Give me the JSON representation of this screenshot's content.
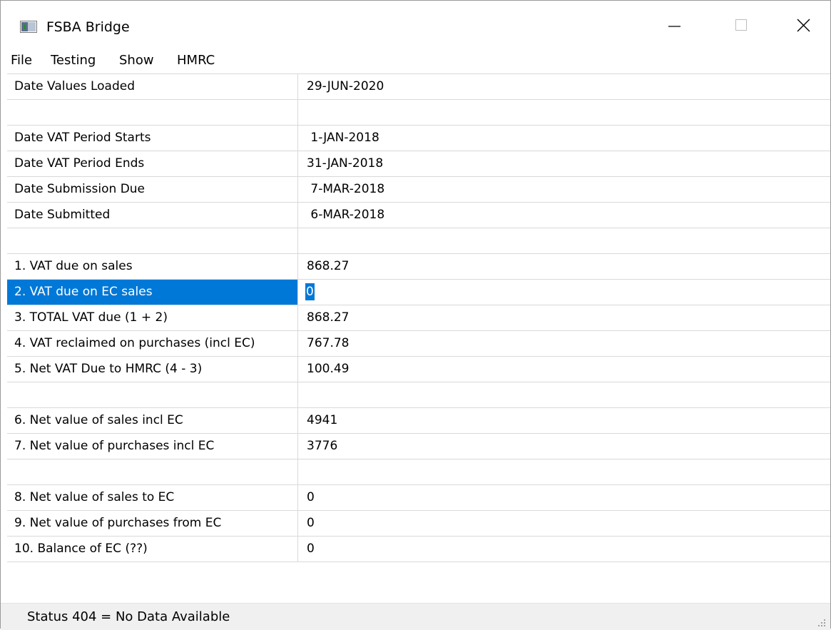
{
  "window": {
    "title": "FSBA Bridge",
    "icon": "app-window-icon",
    "controls": [
      "minimize-icon",
      "maximize-icon",
      "close-icon"
    ]
  },
  "menu": {
    "items": [
      "File",
      "Testing",
      "Show",
      "HMRC"
    ]
  },
  "rows": [
    {
      "label": "Date Values Loaded",
      "value": "29-JUN-2020"
    },
    {
      "label": "",
      "value": ""
    },
    {
      "label": "Date VAT Period Starts",
      "value": " 1-JAN-2018"
    },
    {
      "label": "Date VAT Period Ends",
      "value": "31-JAN-2018"
    },
    {
      "label": "Date Submission Due",
      "value": " 7-MAR-2018"
    },
    {
      "label": "Date Submitted",
      "value": " 6-MAR-2018"
    },
    {
      "label": "",
      "value": ""
    },
    {
      "label": "1. VAT due on sales",
      "value": "868.27"
    },
    {
      "label": "2. VAT due on EC sales",
      "value": "0"
    },
    {
      "label": "3. TOTAL VAT due (1 + 2)",
      "value": "868.27"
    },
    {
      "label": "4. VAT reclaimed on purchases (incl EC)",
      "value": "767.78"
    },
    {
      "label": "5. Net VAT Due to HMRC (4 - 3)",
      "value": "100.49"
    },
    {
      "label": "",
      "value": ""
    },
    {
      "label": "6. Net value of sales incl EC",
      "value": "4941"
    },
    {
      "label": "7. Net value of purchases incl EC",
      "value": "3776"
    },
    {
      "label": "",
      "value": ""
    },
    {
      "label": "8. Net value of sales to EC",
      "value": "0"
    },
    {
      "label": "9. Net value of purchases from EC",
      "value": "0"
    },
    {
      "label": "10. Balance of EC (??)",
      "value": "0"
    }
  ],
  "selected_row": 8,
  "status": {
    "text": "Status 404 = No Data Available"
  },
  "colors": {
    "selection": "#0078d7",
    "grid_line": "#d9d9d9",
    "statusbar_bg": "#f0f0f0"
  }
}
